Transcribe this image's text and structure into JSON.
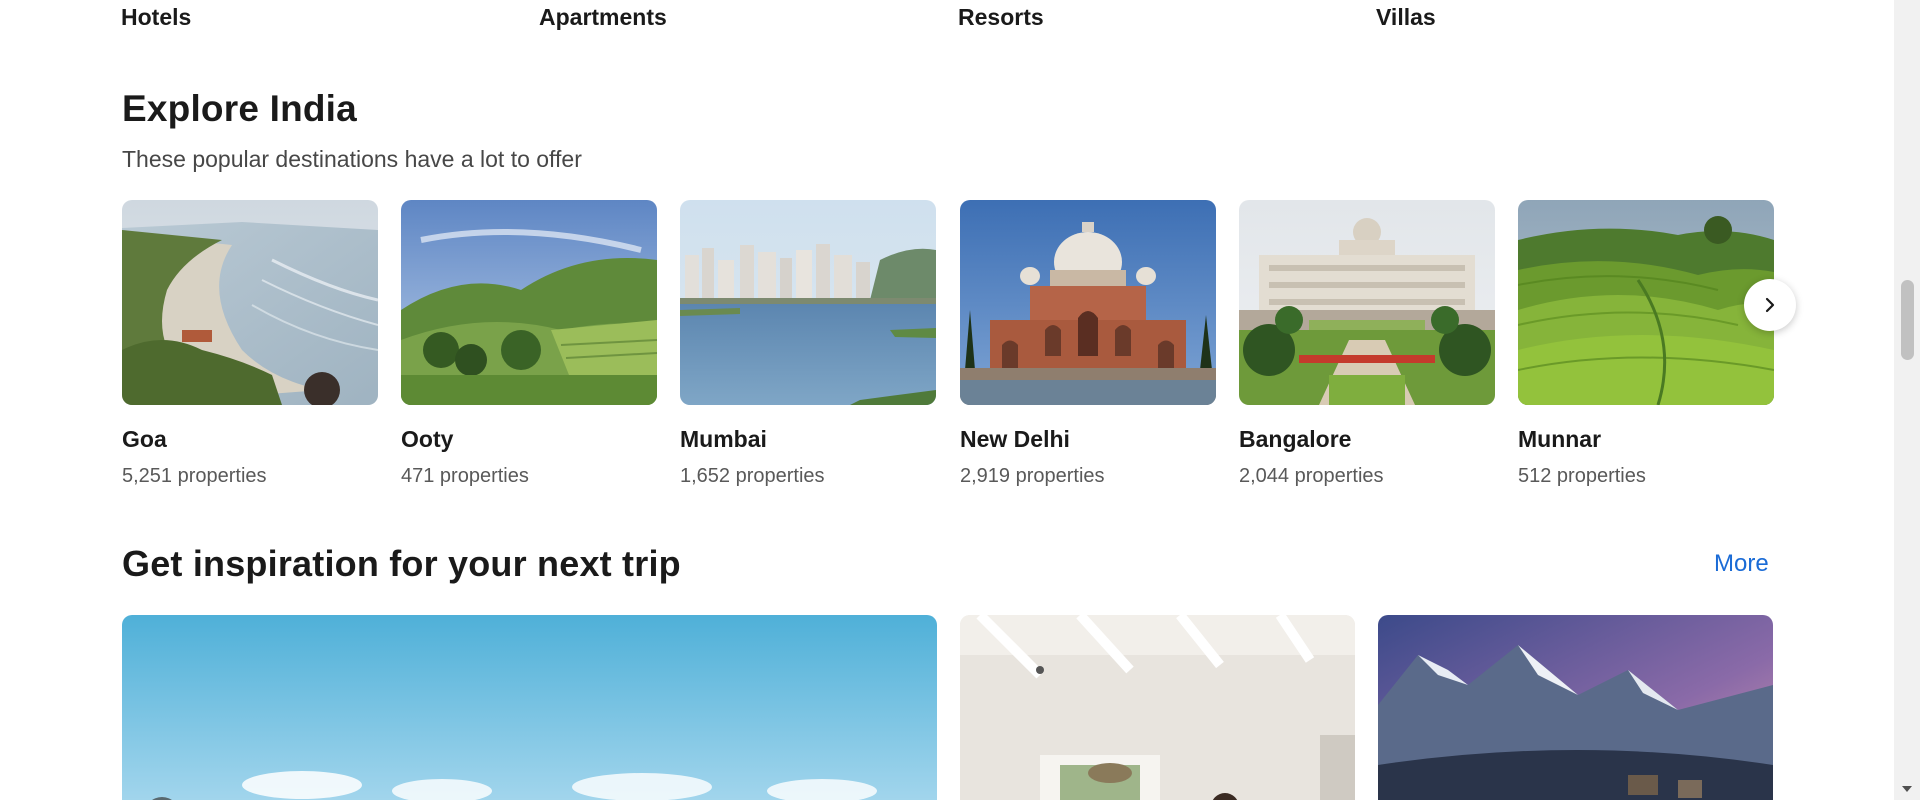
{
  "categories": {
    "items": [
      "Hotels",
      "Apartments",
      "Resorts",
      "Villas"
    ]
  },
  "explore": {
    "title": "Explore India",
    "subtitle": "These popular destinations have a lot to offer",
    "destinations": [
      {
        "name": "Goa",
        "properties": "5,251 properties"
      },
      {
        "name": "Ooty",
        "properties": "471 properties"
      },
      {
        "name": "Mumbai",
        "properties": "1,652 properties"
      },
      {
        "name": "New Delhi",
        "properties": "2,919 properties"
      },
      {
        "name": "Bangalore",
        "properties": "2,044 properties"
      },
      {
        "name": "Munnar",
        "properties": "512 properties"
      }
    ],
    "next_icon": "chevron-right-icon"
  },
  "inspiration": {
    "title": "Get inspiration for your next trip",
    "more_label": "More"
  },
  "colors": {
    "link": "#1a6bd6",
    "text": "#1a1a1a",
    "muted": "#595959"
  }
}
